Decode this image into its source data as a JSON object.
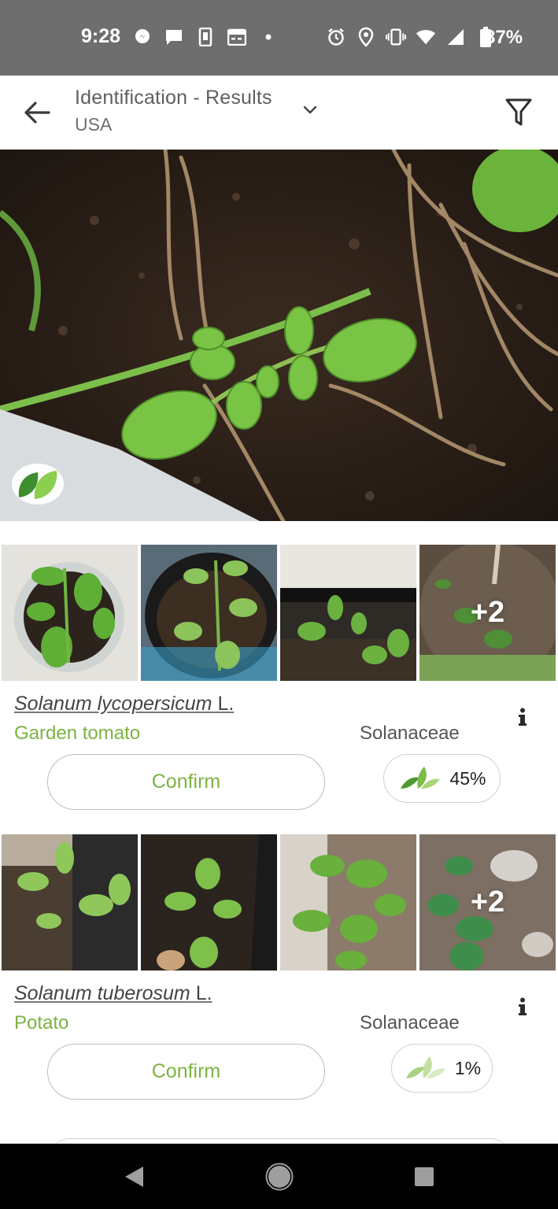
{
  "status_bar": {
    "time": "9:28",
    "battery": "87%",
    "left_icons": [
      "messenger-icon",
      "chat-icon",
      "sim-icon",
      "calendar-icon",
      "dot-icon"
    ],
    "right_icons": [
      "alarm-icon",
      "location-icon",
      "vibrate-icon",
      "wifi-icon",
      "signal-icon",
      "battery-icon"
    ]
  },
  "app_bar": {
    "title": "Identification - Results",
    "subtitle": "USA"
  },
  "results": [
    {
      "genus_species": "Solanum lycopersicum",
      "author": "L.",
      "common_name": "Garden tomato",
      "family": "Solanaceae",
      "confirm_label": "Confirm",
      "score": "45%",
      "more_images": "+2"
    },
    {
      "genus_species": "Solanum tuberosum",
      "author": "L.",
      "common_name": "Potato",
      "family": "Solanaceae",
      "confirm_label": "Confirm",
      "score": "1%",
      "more_images": "+2"
    }
  ],
  "colors": {
    "accent_green": "#7cb342",
    "status_bar": "#6e6e6e",
    "nav_bar": "#000000"
  }
}
